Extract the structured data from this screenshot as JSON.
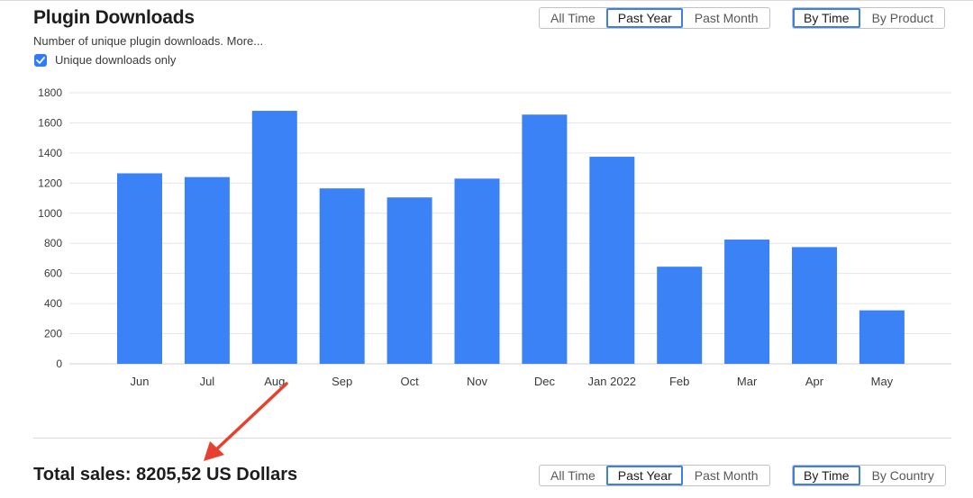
{
  "header": {
    "title": "Plugin Downloads",
    "subtitle": "Number of unique plugin downloads. More...",
    "checkbox": {
      "label": "Unique downloads only",
      "checked": true
    }
  },
  "top_controls": {
    "period_options": [
      "All Time",
      "Past Year",
      "Past Month"
    ],
    "period_selected": "Past Year",
    "group_options": [
      "By Time",
      "By Product"
    ],
    "group_selected": "By Time"
  },
  "bottom_controls": {
    "period_options": [
      "All Time",
      "Past Year",
      "Past Month"
    ],
    "period_selected": "Past Year",
    "group_options": [
      "By Time",
      "By Country"
    ],
    "group_selected": "By Time"
  },
  "footer": {
    "total_sales": "Total sales: 8205,52 US Dollars"
  },
  "colors": {
    "bar": "#3b82f6",
    "accent": "#3d7fe6",
    "arrow": "#e8402f"
  },
  "chart_data": {
    "type": "bar",
    "categories": [
      "Jun",
      "Jul",
      "Aug",
      "Sep",
      "Oct",
      "Nov",
      "Dec",
      "Jan 2022",
      "Feb",
      "Mar",
      "Apr",
      "May"
    ],
    "values": [
      1265,
      1240,
      1680,
      1165,
      1105,
      1230,
      1655,
      1375,
      645,
      825,
      775,
      355
    ],
    "title": "",
    "xlabel": "",
    "ylabel": "",
    "ylim": [
      0,
      1800
    ],
    "yticks": [
      0,
      200,
      400,
      600,
      800,
      1000,
      1200,
      1400,
      1600,
      1800
    ],
    "grid": true
  }
}
